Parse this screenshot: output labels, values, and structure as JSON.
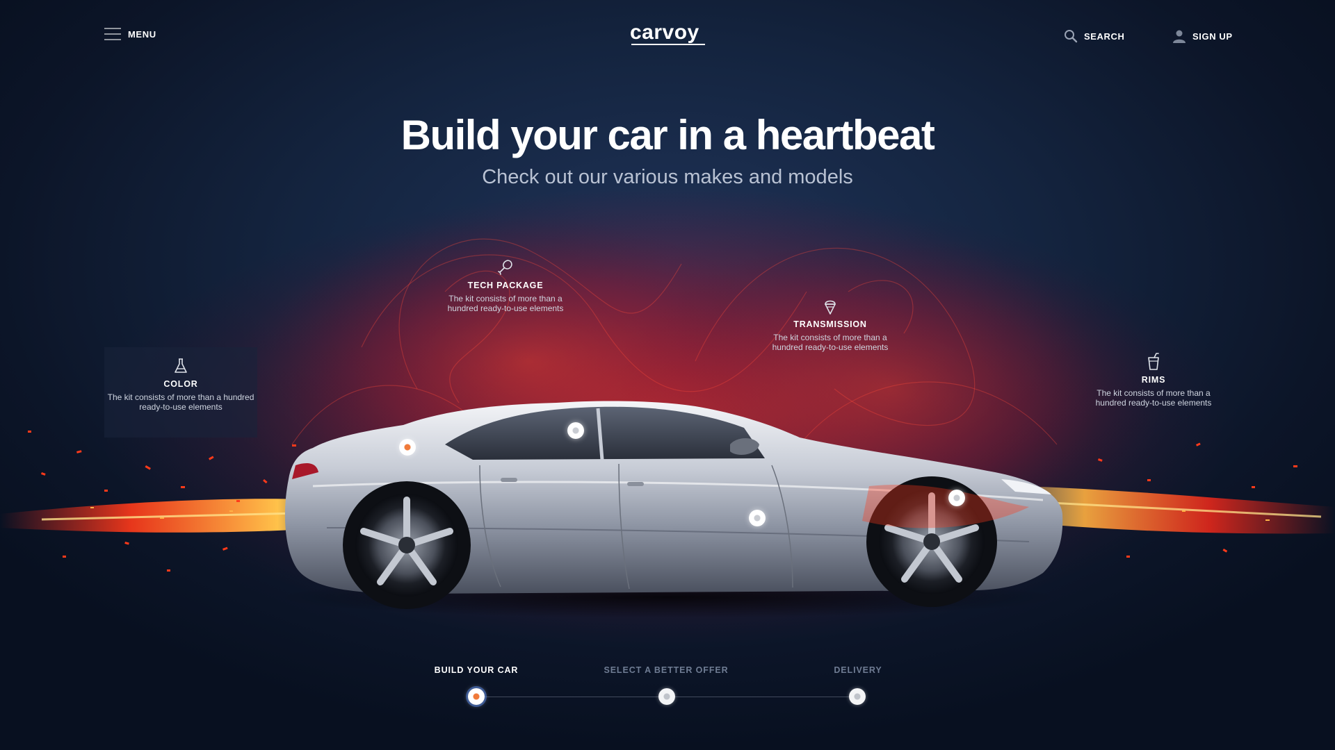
{
  "header": {
    "menu_label": "MENU",
    "logo": "carvoy",
    "search_label": "SEARCH",
    "signup_label": "SIGN UP"
  },
  "hero": {
    "title": "Build your car in a heartbeat",
    "subtitle": "Check out our various makes and models"
  },
  "features": [
    {
      "title": "COLOR",
      "description": "The kit consists of more than a hundred ready-to-use elements",
      "icon": "flask-icon"
    },
    {
      "title": "TECH PACKAGE",
      "description": "The kit consists of more than a hundred ready-to-use elements",
      "icon": "drumstick-icon"
    },
    {
      "title": "TRANSMISSION",
      "description": "The kit consists of more than a hundred ready-to-use elements",
      "icon": "ice-cream-icon"
    },
    {
      "title": "RIMS",
      "description": "The kit consists of more than a hundred ready-to-use elements",
      "icon": "drink-cup-icon"
    }
  ],
  "steps": [
    {
      "label": "BUILD YOUR CAR",
      "active": true
    },
    {
      "label": "SELECT A BETTER OFFER",
      "active": false
    },
    {
      "label": "DELIVERY",
      "active": false
    }
  ],
  "colors": {
    "accent": "#f07a3a",
    "background_dark": "#0c1528",
    "flame_red": "#e8221c",
    "flame_orange": "#ffb347"
  }
}
